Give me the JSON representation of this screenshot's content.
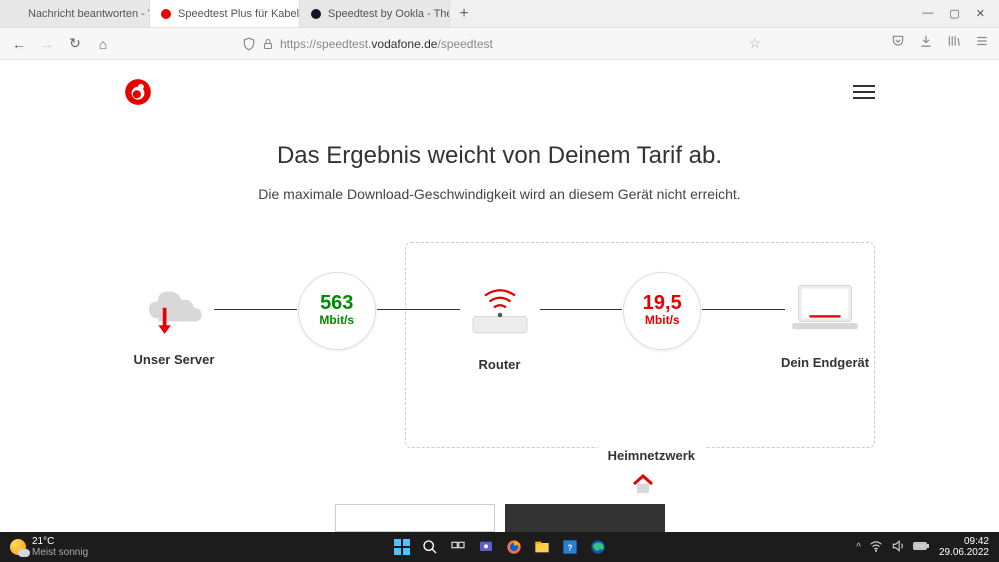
{
  "browser": {
    "tabs": [
      {
        "label": "Nachricht beantworten - Vodafone"
      },
      {
        "label": "Speedtest Plus für Kabel- und D"
      },
      {
        "label": "Speedtest by Ookla - The Globa"
      }
    ],
    "url_prefix": "https://speedtest.",
    "url_domain": "vodafone.de",
    "url_path": "/speedtest"
  },
  "page": {
    "heading": "Das Ergebnis weicht von Deinem Tarif ab.",
    "subheading": "Die maximale Download-Geschwindigkeit wird an diesem Gerät nicht erreicht.",
    "server_label": "Unser Server",
    "router_label": "Router",
    "device_label": "Dein Endgerät",
    "heimnetz_label": "Heimnetzwerk",
    "speed1_value": "563",
    "speed1_unit": "Mbit/s",
    "speed2_value": "19,5",
    "speed2_unit": "Mbit/s"
  },
  "taskbar": {
    "temp": "21°C",
    "weather": "Meist sonnig",
    "time": "09:42",
    "date": "29.06.2022"
  }
}
